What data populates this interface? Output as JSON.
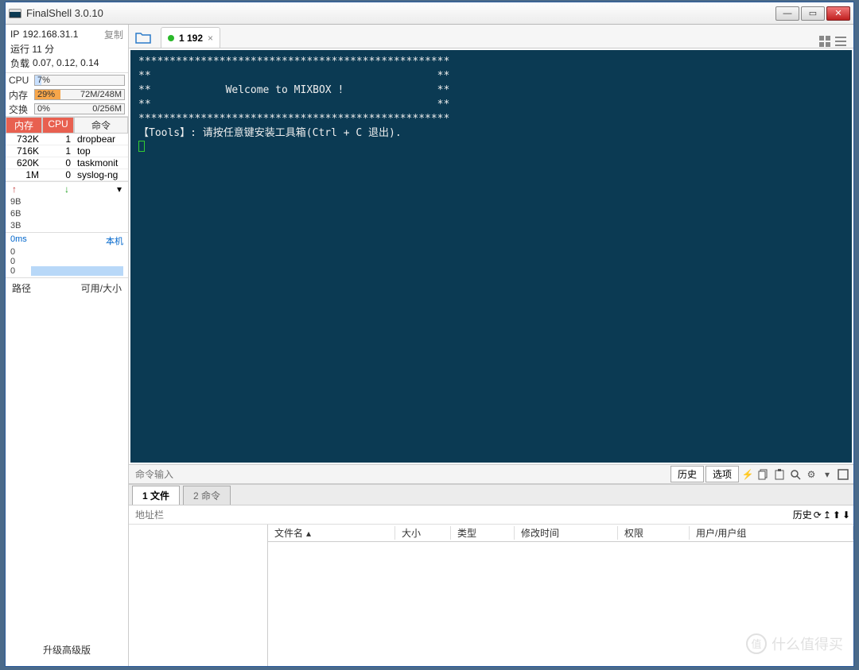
{
  "app": {
    "title": "FinalShell 3.0.10"
  },
  "sidebar": {
    "ip_label": "IP",
    "ip": "192.168.31.1",
    "copy": "复制",
    "uptime": "运行 11 分",
    "load_label": "负载",
    "load": "0.07, 0.12, 0.14",
    "cpu_label": "CPU",
    "cpu_pct": "7%",
    "mem_label": "内存",
    "mem_pct": "29%",
    "mem_val": "72M/248M",
    "swap_label": "交换",
    "swap_pct": "0%",
    "swap_val": "0/256M",
    "proc_headers": {
      "mem": "内存",
      "cpu": "CPU",
      "cmd": "命令"
    },
    "procs": [
      {
        "mem": "732K",
        "cpu": "1",
        "cmd": "dropbear"
      },
      {
        "mem": "716K",
        "cpu": "1",
        "cmd": "top"
      },
      {
        "mem": "620K",
        "cpu": "0",
        "cmd": "taskmonit"
      },
      {
        "mem": "1M",
        "cpu": "0",
        "cmd": "syslog-ng"
      }
    ],
    "net_scale": [
      "9B",
      "6B",
      "3B"
    ],
    "ping_label": "0ms",
    "ping_host": "本机",
    "ping_rows": [
      "0",
      "0",
      "0"
    ],
    "disk": {
      "path": "路径",
      "avail": "可用/大小"
    },
    "upgrade": "升级高级版"
  },
  "tabs": {
    "label": "1 192"
  },
  "terminal": {
    "l1": "**************************************************",
    "l2": "**                                              **",
    "l3": "**            Welcome to MIXBOX !               **",
    "l4": "**                                              **",
    "l5": "**************************************************",
    "l6": "【Tools】: 请按任意键安装工具箱(Ctrl + C 退出)."
  },
  "cmdbar": {
    "placeholder": "命令输入",
    "history": "历史",
    "options": "选项"
  },
  "bottom": {
    "tab1": "1 文件",
    "tab2": "2 命令",
    "addr_placeholder": "地址栏",
    "history": "历史",
    "cols": {
      "name": "文件名",
      "size": "大小",
      "type": "类型",
      "mtime": "修改时间",
      "perm": "权限",
      "owner": "用户/用户组"
    }
  },
  "watermark": "什么值得买"
}
